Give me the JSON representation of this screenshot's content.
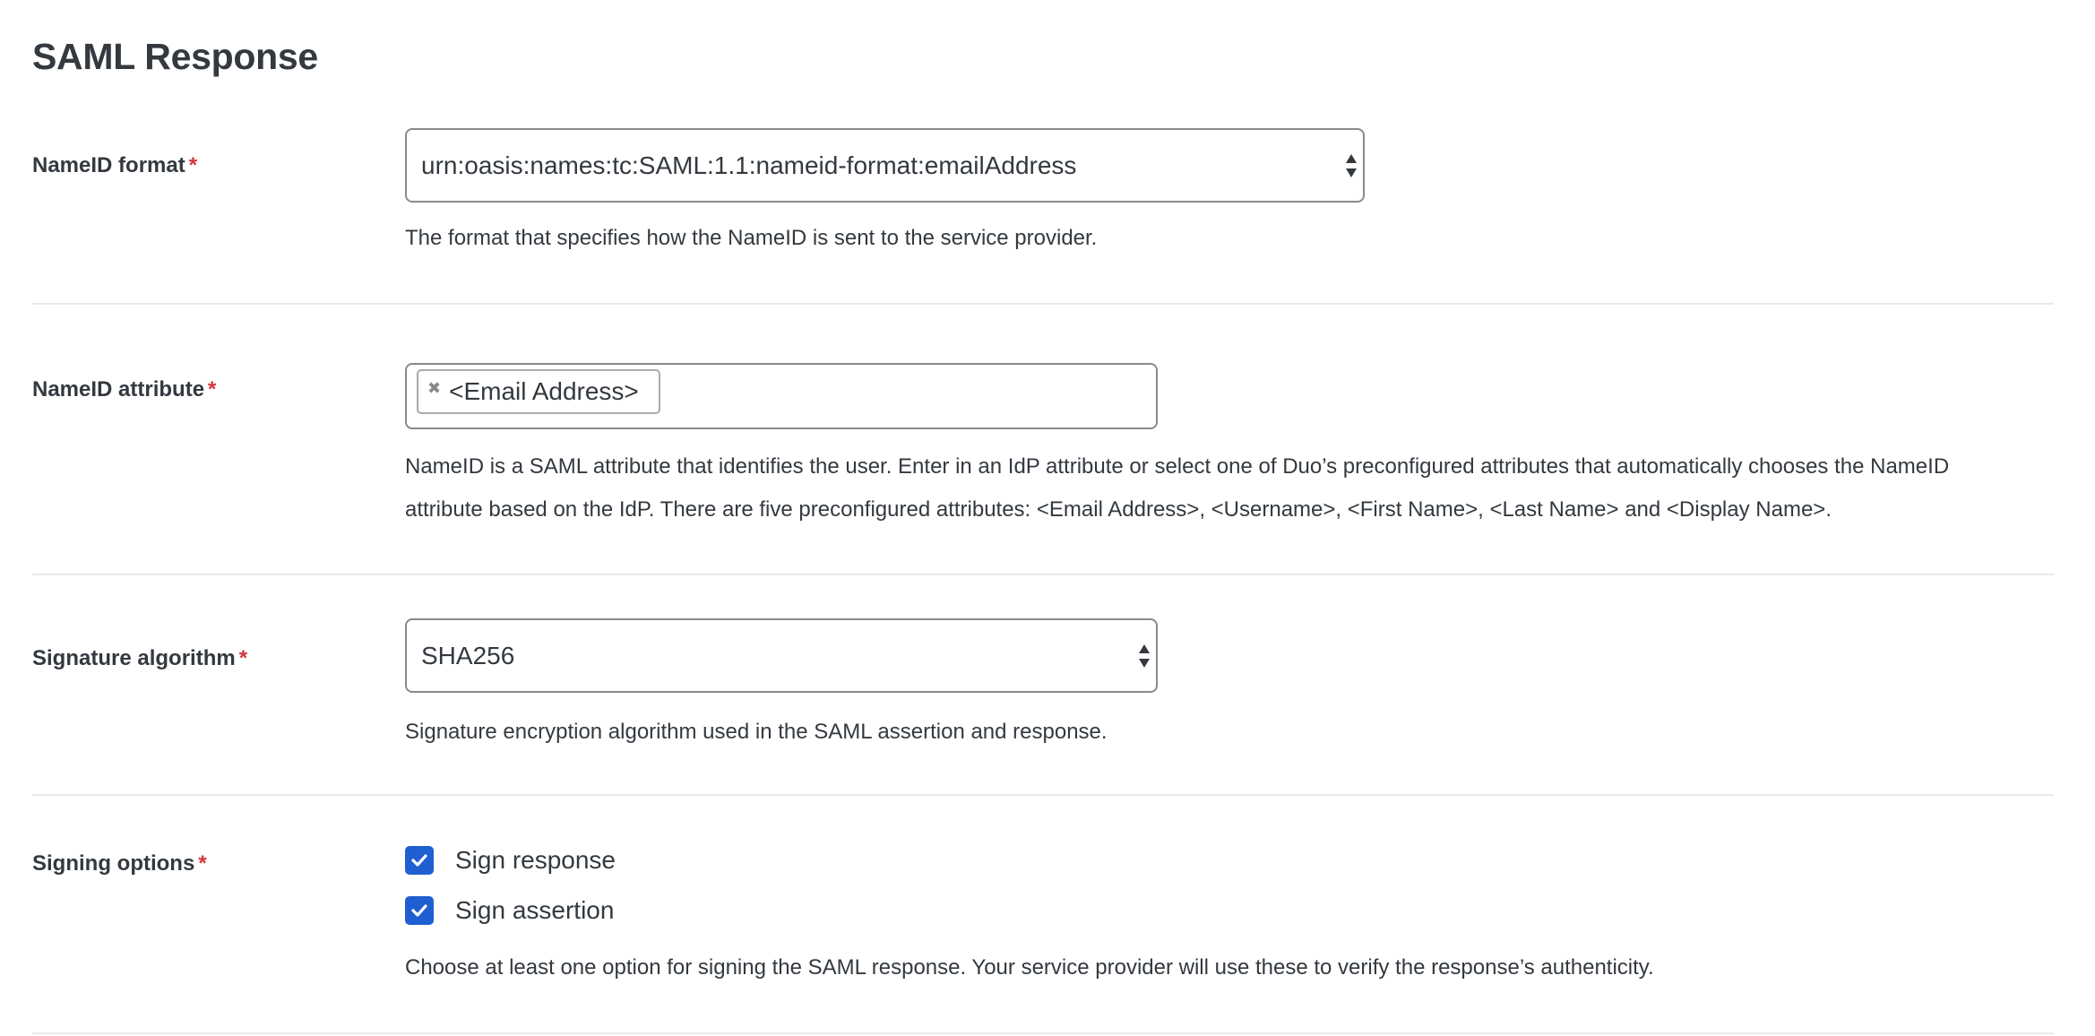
{
  "page": {
    "title": "SAML Response"
  },
  "colors": {
    "accent": "#1f5fd2",
    "required": "#d0343a",
    "text": "#33393f",
    "divider": "#e6eaed"
  },
  "fields": {
    "nameid_format": {
      "label": "NameID format",
      "required_marker": "*",
      "value": "urn:oasis:names:tc:SAML:1.1:nameid-format:emailAddress",
      "help": "The format that specifies how the NameID is sent to the service provider."
    },
    "nameid_attribute": {
      "label": "NameID attribute",
      "required_marker": "*",
      "tags": [
        {
          "text": "<Email Address>",
          "remove_icon": "close-icon"
        }
      ],
      "help_line1": "NameID is a SAML attribute that identifies the user. Enter in an IdP attribute or select one of Duo’s preconfigured attributes that automatically chooses the NameID",
      "help_line2": "attribute based on the IdP. There are five preconfigured attributes: <Email Address>, <Username>, <First Name>, <Last Name> and <Display Name>."
    },
    "signature_algorithm": {
      "label": "Signature algorithm",
      "required_marker": "*",
      "value": "SHA256",
      "help": "Signature encryption algorithm used in the SAML assertion and response."
    },
    "signing_options": {
      "label": "Signing options",
      "required_marker": "*",
      "options": [
        {
          "label": "Sign response",
          "checked": true
        },
        {
          "label": "Sign assertion",
          "checked": true
        }
      ],
      "help": "Choose at least one option for signing the SAML response. Your service provider will use these to verify the response’s authenticity."
    }
  }
}
